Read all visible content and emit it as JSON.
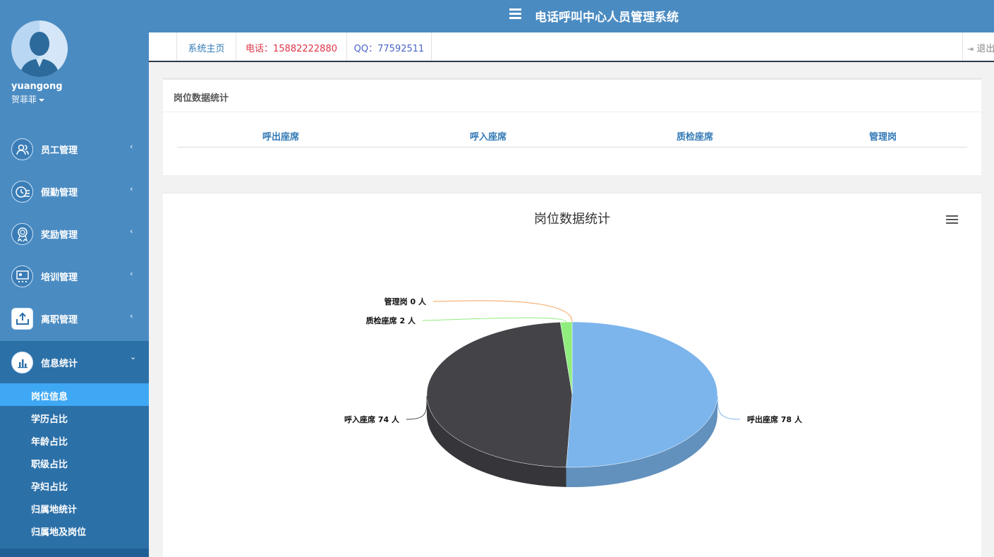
{
  "header": {
    "title": "电话呼叫中心人员管理系统"
  },
  "user": {
    "username": "yuangong",
    "name": "贺菲菲"
  },
  "tabs": [
    {
      "label": "系统主页",
      "color": "#337ab7"
    },
    {
      "label": "电话：15882222880",
      "color": "#dc3545"
    },
    {
      "label": "QQ：77592511",
      "color": "#4a64c8"
    }
  ],
  "logout": {
    "label": "退出"
  },
  "menu": [
    {
      "label": "员工管理",
      "icon": "users-icon"
    },
    {
      "label": "假勤管理",
      "icon": "clock-list-icon"
    },
    {
      "label": "奖励管理",
      "icon": "award-ribbon-icon"
    },
    {
      "label": "培训管理",
      "icon": "training-screen-icon"
    },
    {
      "label": "离职管理",
      "icon": "upload-tray-icon"
    },
    {
      "label": "信息统计",
      "icon": "bar-chart-icon"
    }
  ],
  "submenu": [
    "岗位信息",
    "学历占比",
    "年龄占比",
    "职级占比",
    "孕妇占比",
    "归属地统计",
    "归属地及岗位"
  ],
  "stats_panel": {
    "title": "岗位数据统计",
    "columns": [
      "呼出座席",
      "呼入座席",
      "质检座席",
      "管理岗"
    ]
  },
  "chart_data": {
    "type": "pie",
    "title": "岗位数据统计",
    "unit": "人",
    "labels": [
      "呼出座席 78 人",
      "呼入座席 74 人",
      "质检座席 2 人",
      "管理岗 0 人"
    ],
    "slices": [
      {
        "name": "呼出座席",
        "value": 78,
        "color": "#7cb5ec"
      },
      {
        "name": "呼入座席",
        "value": 74,
        "color": "#434348"
      },
      {
        "name": "质检座席",
        "value": 2,
        "color": "#90ed7d"
      },
      {
        "name": "管理岗",
        "value": 0,
        "color": "#f7a35c"
      }
    ]
  }
}
